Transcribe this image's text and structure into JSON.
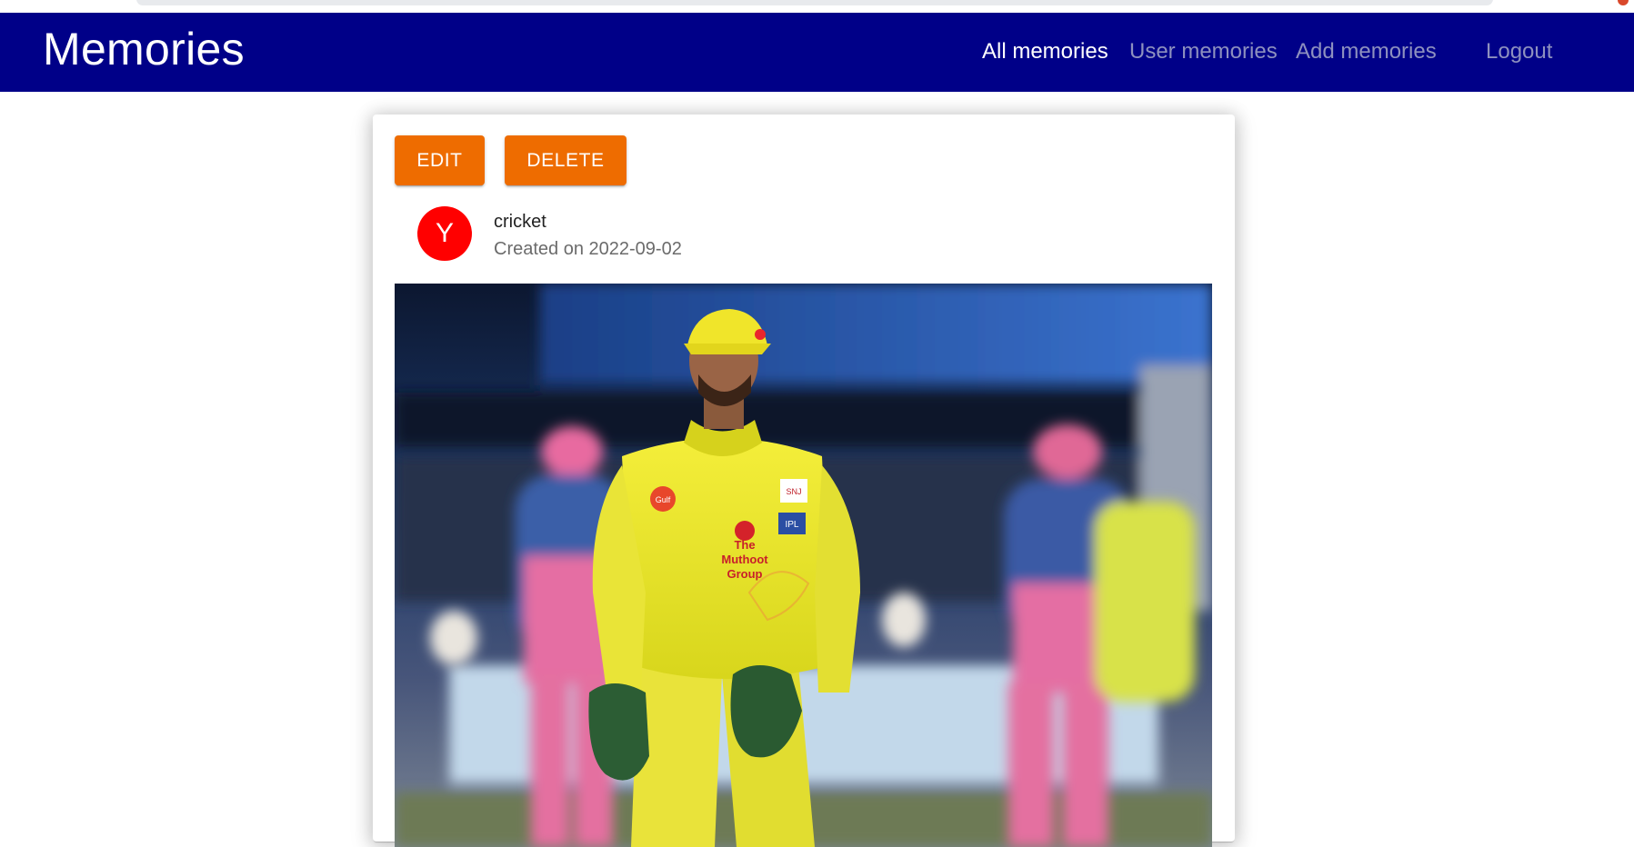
{
  "navbar": {
    "brand": "Memories",
    "links": [
      {
        "label": "All memories",
        "active": true
      },
      {
        "label": "User memories",
        "active": false
      },
      {
        "label": "Add memories",
        "active": false
      }
    ],
    "logout_label": "Logout",
    "background_color": "#000088"
  },
  "card": {
    "edit_label": "EDIT",
    "delete_label": "DELETE",
    "button_color": "#ee6c00",
    "avatar_initial": "Y",
    "avatar_color": "#ff0000",
    "title": "cricket",
    "created": "Created on 2022-09-02",
    "photo": {
      "subject": "cricket wicketkeeper in yellow jersey",
      "jersey_text": [
        "The",
        "Muthoot",
        "Group"
      ],
      "badge_text": [
        "Gulf",
        "IPL",
        "SNJ"
      ]
    }
  }
}
